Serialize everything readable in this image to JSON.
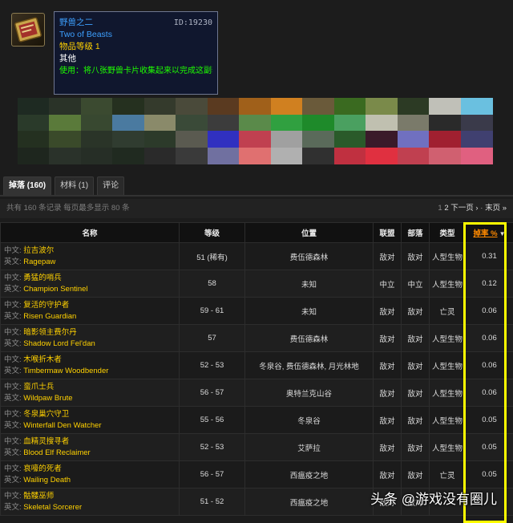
{
  "item": {
    "icon": "beast-card-icon",
    "name_cn": "野兽之二",
    "id_label": "ID:19230",
    "name_en": "Two of Beasts",
    "item_level": "物品等级 1",
    "category": "其他",
    "use_text": "使用：将八张野兽卡片收集起来以完成这副套牌。"
  },
  "tabs": [
    {
      "label": "掉落 (160)",
      "active": true
    },
    {
      "label": "材料 (1)",
      "active": false
    },
    {
      "label": "评论",
      "active": false
    }
  ],
  "info": {
    "summary": "共有 160 条记录 每页最多显示 80 条",
    "page_current": "1",
    "page_next_num": "2",
    "next": "下一页 ›",
    "last": "末页 »"
  },
  "table": {
    "headers": {
      "name": "名称",
      "level": "等级",
      "location": "位置",
      "alliance": "联盟",
      "horde": "部落",
      "type": "类型",
      "droprate": "掉率 %"
    },
    "lang_cn": "中文:",
    "lang_en": "英文:",
    "rows": [
      {
        "cn": "拉吉波尔",
        "en": "Ragepaw",
        "level": "51 (稀有)",
        "location": "费伍德森林",
        "alliance": "敌对",
        "horde": "敌对",
        "type": "人型生物",
        "rate": "0.31"
      },
      {
        "cn": "勇猛的哨兵",
        "en": "Champion Sentinel",
        "level": "58",
        "location": "未知",
        "alliance": "中立",
        "horde": "中立",
        "type": "人型生物",
        "rate": "0.12"
      },
      {
        "cn": "复活的守护者",
        "en": "Risen Guardian",
        "level": "59 - 61",
        "location": "未知",
        "alliance": "敌对",
        "horde": "敌对",
        "type": "亡灵",
        "rate": "0.06"
      },
      {
        "cn": "暗影领主费尔丹",
        "en": "Shadow Lord Fel'dan",
        "level": "57",
        "location": "费伍德森林",
        "alliance": "敌对",
        "horde": "敌对",
        "type": "人型生物",
        "rate": "0.06"
      },
      {
        "cn": "木喉折木者",
        "en": "Timbermaw Woodbender",
        "level": "52 - 53",
        "location": "冬泉谷, 费伍德森林, 月光林地",
        "alliance": "敌对",
        "horde": "敌对",
        "type": "人型生物",
        "rate": "0.06"
      },
      {
        "cn": "蛮爪士兵",
        "en": "Wildpaw Brute",
        "level": "56 - 57",
        "location": "奥特兰克山谷",
        "alliance": "敌对",
        "horde": "敌对",
        "type": "人型生物",
        "rate": "0.06"
      },
      {
        "cn": "冬泉巢穴守卫",
        "en": "Winterfall Den Watcher",
        "level": "55 - 56",
        "location": "冬泉谷",
        "alliance": "敌对",
        "horde": "敌对",
        "type": "人型生物",
        "rate": "0.05"
      },
      {
        "cn": "血精灵搜寻者",
        "en": "Blood Elf Reclaimer",
        "level": "52 - 53",
        "location": "艾萨拉",
        "alliance": "敌对",
        "horde": "敌对",
        "type": "人型生物",
        "rate": "0.05"
      },
      {
        "cn": "哀嚎的死者",
        "en": "Wailing Death",
        "level": "56 - 57",
        "location": "西瘟疫之地",
        "alliance": "敌对",
        "horde": "敌对",
        "type": "亡灵",
        "rate": "0.05"
      },
      {
        "cn": "骷髅巫师",
        "en": "Skeletal Sorcerer",
        "level": "51 - 52",
        "location": "西瘟疫之地",
        "alliance": "敌对",
        "horde": "敌对",
        "type": "",
        "rate": ""
      }
    ]
  },
  "watermark": "头条 @游戏没有圈儿",
  "colors": {
    "highlight": "#ffff00",
    "hostile": "#d42020",
    "neutral": "#e6c000",
    "link": "#ffd100",
    "tooltip_bg": "#10172e"
  }
}
